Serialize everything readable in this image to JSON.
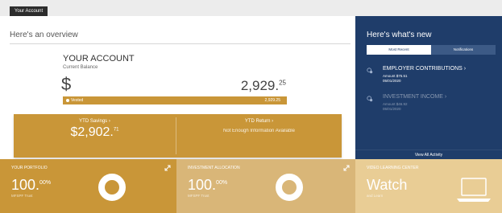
{
  "topbar": {
    "tab_label": "Your Account"
  },
  "overview": {
    "heading": "Here's an overview",
    "account_title": "YOUR ACCOUNT",
    "current_balance_label": "Current Balance",
    "currency_symbol": "$",
    "balance_whole": "2,929.",
    "balance_cents": "25",
    "vested_label": "Vested",
    "vested_value": "2,929.25",
    "ytd_savings_label": "YTD Savings ›",
    "ytd_savings_whole": "$2,902.",
    "ytd_savings_cents": "71",
    "ytd_return_label": "YTD Return ›",
    "ytd_return_message": "Not Enough Information Available",
    "colors": {
      "gold": "#c99638",
      "text": "#444444"
    }
  },
  "whats_new": {
    "title": "Here's what's new",
    "tabs": [
      {
        "label": "Most Recent",
        "active": true
      },
      {
        "label": "Notifications",
        "active": false
      }
    ],
    "items": [
      {
        "icon": "coins-icon",
        "title": "EMPLOYER CONTRIBUTIONS ›",
        "line1": "Amount $75.51",
        "line2": "05/01/2020"
      },
      {
        "icon": "coins-icon",
        "title": "INVESTMENT INCOME ›",
        "line1": "Amount $46.92",
        "line2": "05/01/2020"
      }
    ],
    "view_all": "View All Activity",
    "colors": {
      "background": "#1f3d6a"
    }
  },
  "tiles": {
    "portfolio": {
      "label": "YOUR PORTFOLIO",
      "value_whole": "100.",
      "value_cents": "00%",
      "sublabel": "MFSPF Trust",
      "color": "#c99638"
    },
    "allocation": {
      "label": "INVESTMENT ALLOCATION",
      "value_whole": "100.",
      "value_cents": "00%",
      "sublabel": "MFSPF Trust",
      "color": "#d9b678"
    },
    "video": {
      "label": "VIDEO LEARNING CENTER",
      "headline": "Watch",
      "sublabel": "and Learn",
      "color": "#e9cd95"
    }
  }
}
